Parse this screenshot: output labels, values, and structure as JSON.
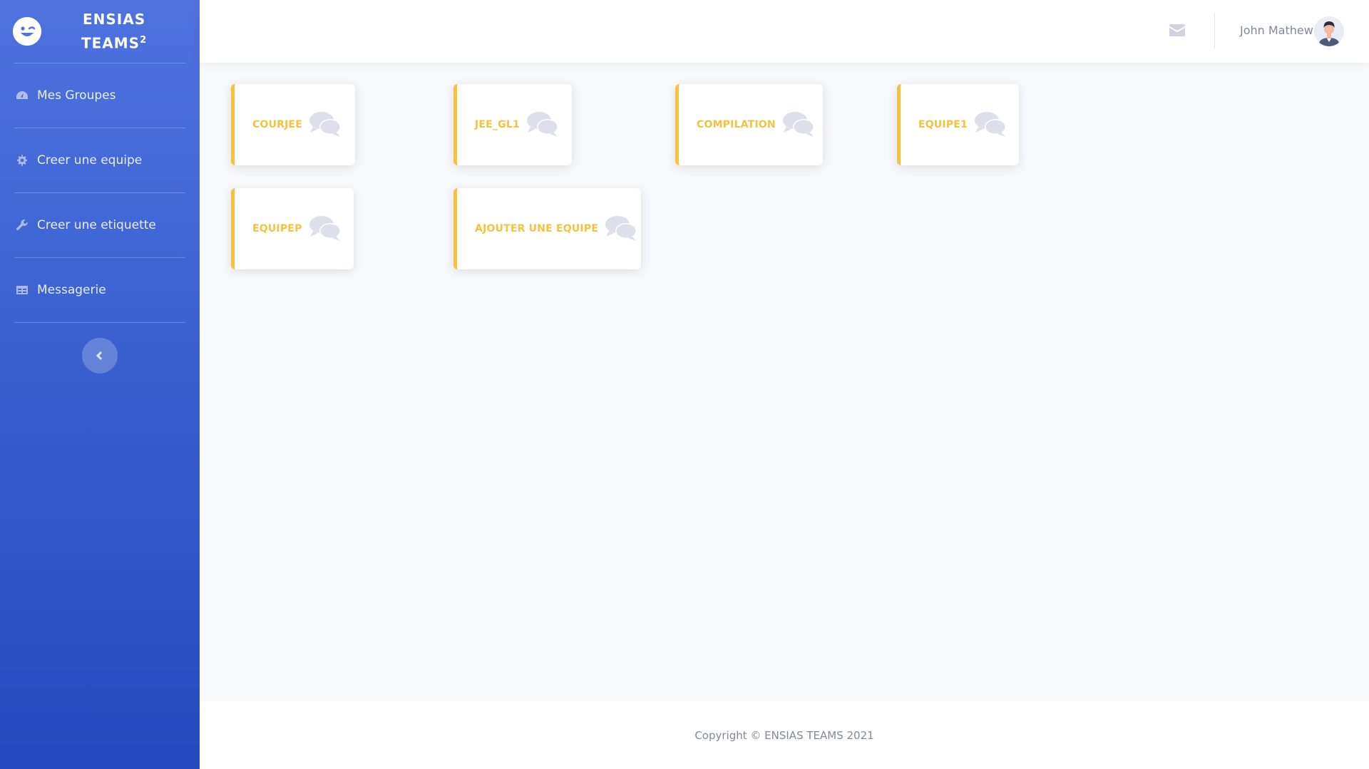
{
  "brand": {
    "logo_icon": "wink-face-icon",
    "line1": "ENSIAS",
    "line2": "TEAMS",
    "superscript": "2"
  },
  "sidebar": {
    "items": [
      {
        "label": "Mes Groupes",
        "icon": "tachometer-icon"
      },
      {
        "label": "Creer une equipe",
        "icon": "gear-icon"
      },
      {
        "label": "Creer une etiquette",
        "icon": "wrench-icon"
      },
      {
        "label": "Messagerie",
        "icon": "table-icon"
      }
    ],
    "toggle_icon": "chevron-left-icon"
  },
  "topbar": {
    "mail_icon": "envelope-icon",
    "user_name": "John Mathew"
  },
  "cards": [
    {
      "label": "COURJEE",
      "icon": "comments-icon"
    },
    {
      "label": "JEE_GL1",
      "icon": "comments-icon"
    },
    {
      "label": "COMPILATION",
      "icon": "comments-icon"
    },
    {
      "label": "EQUIPE1",
      "icon": "comments-icon"
    },
    {
      "label": "EQUIPEP",
      "icon": "comments-icon"
    },
    {
      "label": "AJOUTER UNE EQUIPE",
      "icon": "comments-icon"
    }
  ],
  "footer": {
    "copyright": "Copyright © ENSIAS TEAMS 2021"
  },
  "colors": {
    "sidebar_top": "#4e73df",
    "sidebar_bottom": "#224abe",
    "card_accent": "#f6c23e",
    "background": "#f8f9fc"
  }
}
